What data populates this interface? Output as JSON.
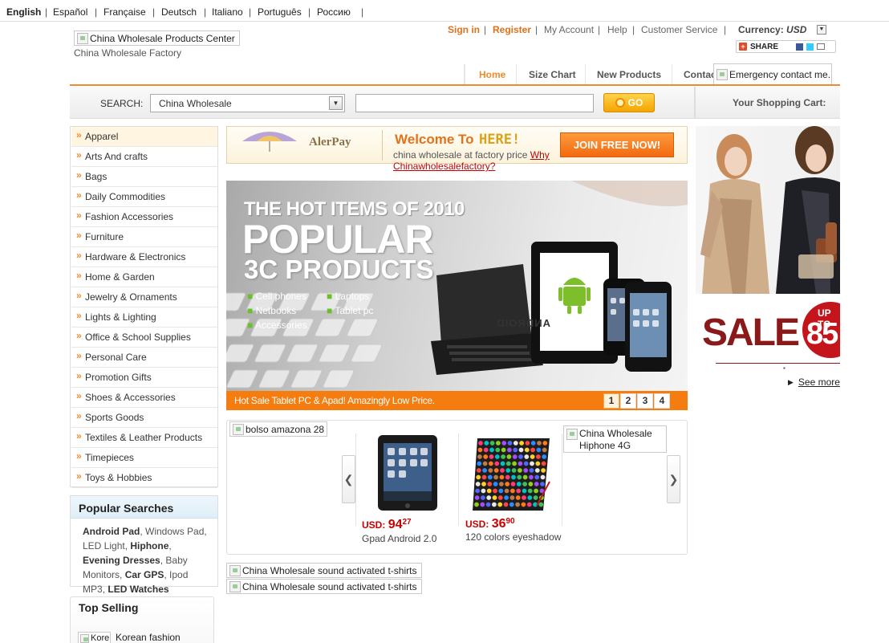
{
  "languages": [
    "English",
    "Español",
    "Française",
    "Deutsch",
    "Italiano",
    "Português",
    "Россию"
  ],
  "logo": {
    "alt": "China Wholesale Products Center",
    "tagline": "China Wholesale Factory"
  },
  "header_links": {
    "sign_in": "Sign in",
    "register": "Register",
    "my_account": "My Account",
    "help": "Help",
    "customer_service": "Customer Service",
    "currency_label": "Currency:",
    "currency_value": "USD",
    "share": "SHARE"
  },
  "nav_tabs": [
    "Home",
    "Size Chart",
    "New Products",
    "Contact"
  ],
  "emergency_alt": "Emergency contact me.",
  "search": {
    "label": "SEARCH:",
    "category": "China Wholesale",
    "go": "GO",
    "cart_label": "Your Shopping Cart:"
  },
  "categories": [
    "Apparel",
    "Arts And crafts",
    "Bags",
    "Daily Commodities",
    "Fashion Accessories",
    "Furniture",
    "Hardware & Electronics",
    "Home & Garden",
    "Jewelry & Ornaments",
    "Lights & Lighting",
    "Office & School Supplies",
    "Personal Care",
    "Promotion Gifts",
    "Shoes & Accessories",
    "Sports Goods",
    "Textiles & Leather Products",
    "Timepieces",
    "Toys & Hobbies"
  ],
  "popular_searches": {
    "title": "Popular Searches",
    "items": [
      {
        "text": "Android Pad",
        "bold": true
      },
      {
        "text": "Windows Pad",
        "bold": false
      },
      {
        "text": "LED Light",
        "bold": false
      },
      {
        "text": "Hiphone",
        "bold": true
      },
      {
        "text": "Evening Dresses",
        "bold": true
      },
      {
        "text": "Baby Monitors",
        "bold": false
      },
      {
        "text": "Car GPS",
        "bold": true
      },
      {
        "text": "Ipod MP3",
        "bold": false
      },
      {
        "text": "LED Watches",
        "bold": true
      }
    ]
  },
  "top_selling": {
    "title": "Top Selling",
    "item_alt": "Kore",
    "item_name": "Korean fashion"
  },
  "welcome": {
    "brand": "AlerPay",
    "title": "Welcome To",
    "here": "HERE!",
    "text": "china wholesale at factory price",
    "why_link": "Why Chinawholesalefactory?",
    "join": "JOIN FREE NOW!"
  },
  "banner": {
    "line1": "THE HOT ITEMS OF 2010",
    "line2": "POPULAR",
    "line3": "3C PRODUCTS",
    "bullets": [
      "Cell phones",
      "Laptops",
      "Netbooks",
      "Tablet pc",
      "Accessories"
    ],
    "android_text": "ANDROID",
    "caption": "Hot Sale Tablet PC & Apad! Amazingly Low Price.",
    "pages": [
      "1",
      "2",
      "3",
      "4"
    ]
  },
  "products": {
    "left_alt": "bolso amazona 28",
    "right_alt": "China Wholesale Hiphone 4G",
    "items": [
      {
        "currency": "USD:",
        "price_int": "94",
        "price_dec": "27",
        "name": "Gpad  Android 2.0"
      },
      {
        "currency": "USD:",
        "price_int": "36",
        "price_dec": "90",
        "name": "120 colors eyeshadow"
      }
    ]
  },
  "bottom_alts": [
    "China Wholesale sound activated t-shirts",
    "China Wholesale sound activated t-shirts"
  ],
  "sale": {
    "word": "SALE",
    "up_to": "UP TO",
    "pct": "85",
    "see_more": "See more"
  },
  "colors": {
    "accent": "#f08a2e",
    "link_red": "#c70000",
    "sale_red": "#8a1a1a"
  }
}
